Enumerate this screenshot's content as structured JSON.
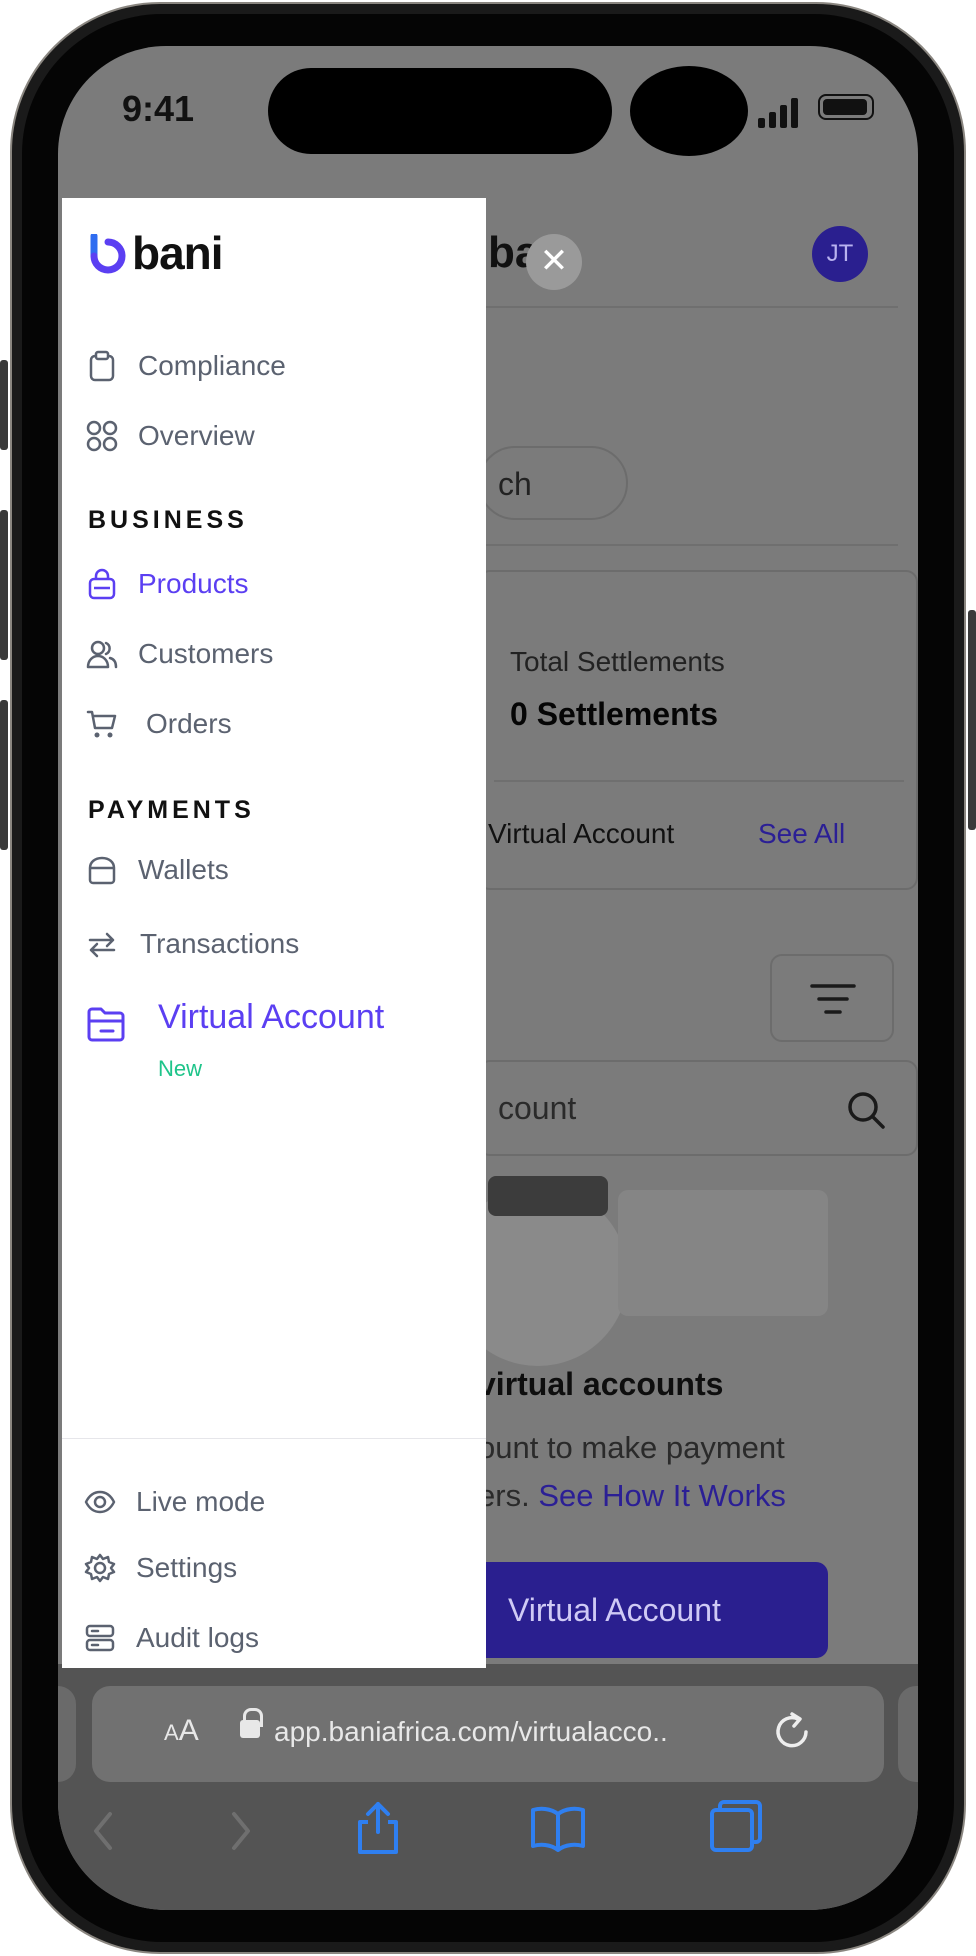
{
  "status_bar": {
    "time": "9:41"
  },
  "background_page": {
    "logo_fragment": "ba",
    "avatar_initials": "JT",
    "search_fragment": "ch",
    "total_settlements_label": "Total Settlements",
    "total_settlements_value": "0 Settlements",
    "virtual_account_label": "Virtual Account",
    "see_all": "See All",
    "search_fragment_2": "count",
    "empty_title": "virtual accounts",
    "empty_sub_line1": "ount to make payment",
    "empty_sub_line2": "ers.",
    "empty_link": "See How It Works",
    "cta_label": "Virtual Account"
  },
  "drawer": {
    "brand": "bani",
    "top_items": [
      {
        "label": "Compliance",
        "icon": "clipboard-icon"
      },
      {
        "label": "Overview",
        "icon": "grid-icon"
      }
    ],
    "business_section": "BUSINESS",
    "business_items": [
      {
        "label": "Products",
        "icon": "bag-icon",
        "active": true
      },
      {
        "label": "Customers",
        "icon": "users-icon"
      },
      {
        "label": "Orders",
        "icon": "cart-icon"
      }
    ],
    "payments_section": "PAYMENTS",
    "payments_items": [
      {
        "label": "Wallets",
        "icon": "wallet-icon"
      },
      {
        "label": "Transactions",
        "icon": "transfer-icon"
      },
      {
        "label": "Virtual Account",
        "icon": "folder-card-icon",
        "badge": "New"
      }
    ],
    "footer_items": [
      {
        "label": "Live mode",
        "icon": "eye-icon"
      },
      {
        "label": "Settings",
        "icon": "gear-icon"
      },
      {
        "label": "Audit logs",
        "icon": "server-icon"
      }
    ]
  },
  "browser": {
    "aa_small": "A",
    "aa_large": "A",
    "url": "app.baniafrica.com/virtualacco.."
  },
  "colors": {
    "brand_purple": "#5b3ff2",
    "dark_purple": "#2a1f8f",
    "badge_green": "#1fc48a",
    "ios_blue": "#2f7ff0"
  }
}
